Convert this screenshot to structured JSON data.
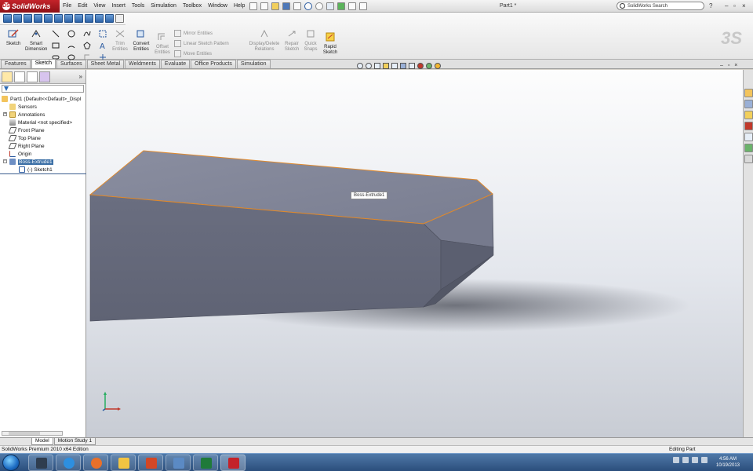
{
  "app": {
    "logo_text": "SolidWorks",
    "document_title": "Part1 *",
    "search_placeholder": "SolidWorks Search",
    "help_label": "?"
  },
  "menu": [
    "File",
    "Edit",
    "View",
    "Insert",
    "Tools",
    "Simulation",
    "Toolbox",
    "Window",
    "Help"
  ],
  "commands": {
    "sketch": "Sketch",
    "smart_dimension": [
      "Smart",
      "Dimension"
    ],
    "trim": [
      "Trim",
      "Entities"
    ],
    "convert": [
      "Convert",
      "Entities"
    ],
    "offset": [
      "Offset",
      "Entities"
    ],
    "mirror": "Mirror Entities",
    "linear_pattern": "Linear Sketch Pattern",
    "move": "Move Entities",
    "display_delete": [
      "Display/Delete",
      "Relations"
    ],
    "repair": [
      "Repair",
      "Sketch"
    ],
    "quick_snaps": [
      "Quick",
      "Snaps"
    ],
    "rapid_sketch": [
      "Rapid",
      "Sketch"
    ]
  },
  "tabs": [
    "Features",
    "Sketch",
    "Surfaces",
    "Sheet Metal",
    "Weldments",
    "Evaluate",
    "Office Products",
    "Simulation"
  ],
  "active_tab": "Sketch",
  "tree": {
    "root": "Part1  (Default<<Default>_Displ",
    "sensors": "Sensors",
    "annotations": "Annotations",
    "material": "Material <not specified>",
    "front_plane": "Front Plane",
    "top_plane": "Top Plane",
    "right_plane": "Right Plane",
    "origin": "Origin",
    "boss_extrude": "Boss-Extrude1",
    "sketch": "(-) Sketch1"
  },
  "graphics": {
    "tooltip": "Boss-Extrude1"
  },
  "model_tabs": [
    "Model",
    "Motion Study 1"
  ],
  "status": {
    "left": "SolidWorks Premium 2010 x64 Edition",
    "right": "Editing Part"
  },
  "taskbar": {
    "time": "4:56 AM",
    "date": "10/19/2013"
  },
  "colors": {
    "brand_red": "#c4232a",
    "selection_blue": "#3a6ea5",
    "part_face": "#6d7184",
    "edge_highlight": "#e08a2e"
  }
}
